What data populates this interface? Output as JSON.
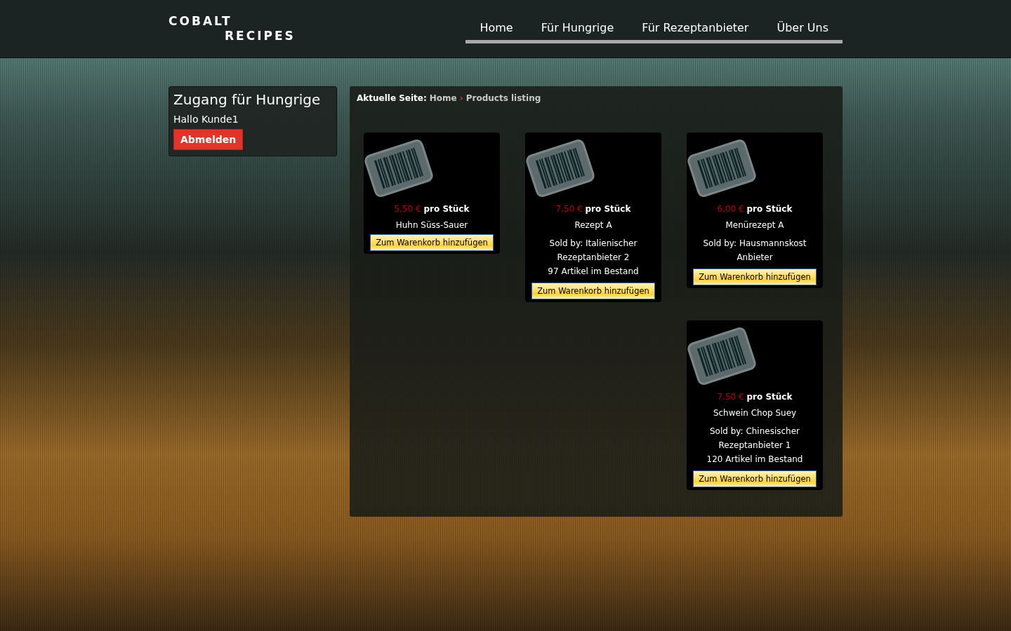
{
  "logo": {
    "line_1": "COBALT",
    "line_2": "RECIPES"
  },
  "nav": [
    {
      "label": "Home",
      "selected": false
    },
    {
      "label": "Für Hungrige",
      "selected": false
    },
    {
      "label": "Für Rezeptanbieter",
      "selected": false
    },
    {
      "label": "Über Uns",
      "selected": false
    }
  ],
  "login_box": {
    "title": "Zugang für Hungrige",
    "greeting": "Hallo Kunde1",
    "logout_button": "Abmelden"
  },
  "breadcrumb": {
    "label": "Aktuelle Seite:",
    "items": [
      {
        "text": "Home"
      },
      {
        "text": "Products listing"
      }
    ],
    "separator": "›"
  },
  "products": [
    {
      "price": "5,50 €",
      "unit": "pro Stück",
      "name": "Huhn Süss-Sauer",
      "button": "Zum Warenkorb hinzufügen"
    },
    {
      "price": "7,50 €",
      "unit": "pro Stück",
      "name": "Rezept A",
      "sold_by": "Sold by: Italienischer Rezeptanbieter 2",
      "stock": "97 Artikel im Bestand",
      "button": "Zum Warenkorb hinzufügen"
    },
    {
      "price": "6,00 €",
      "unit": "pro Stück",
      "name": "Menürezept A",
      "sold_by": "Sold by: Hausmannskost Anbieter",
      "button": "Zum Warenkorb hinzufügen"
    },
    {
      "price": "7,50 €",
      "unit": "pro Stück",
      "name": "Schwein Chop Suey",
      "sold_by": "Sold by: Chinesischer Rezeptanbieter 1",
      "stock": "120 Artikel im Bestand",
      "button": "Zum Warenkorb hinzufügen"
    }
  ]
}
